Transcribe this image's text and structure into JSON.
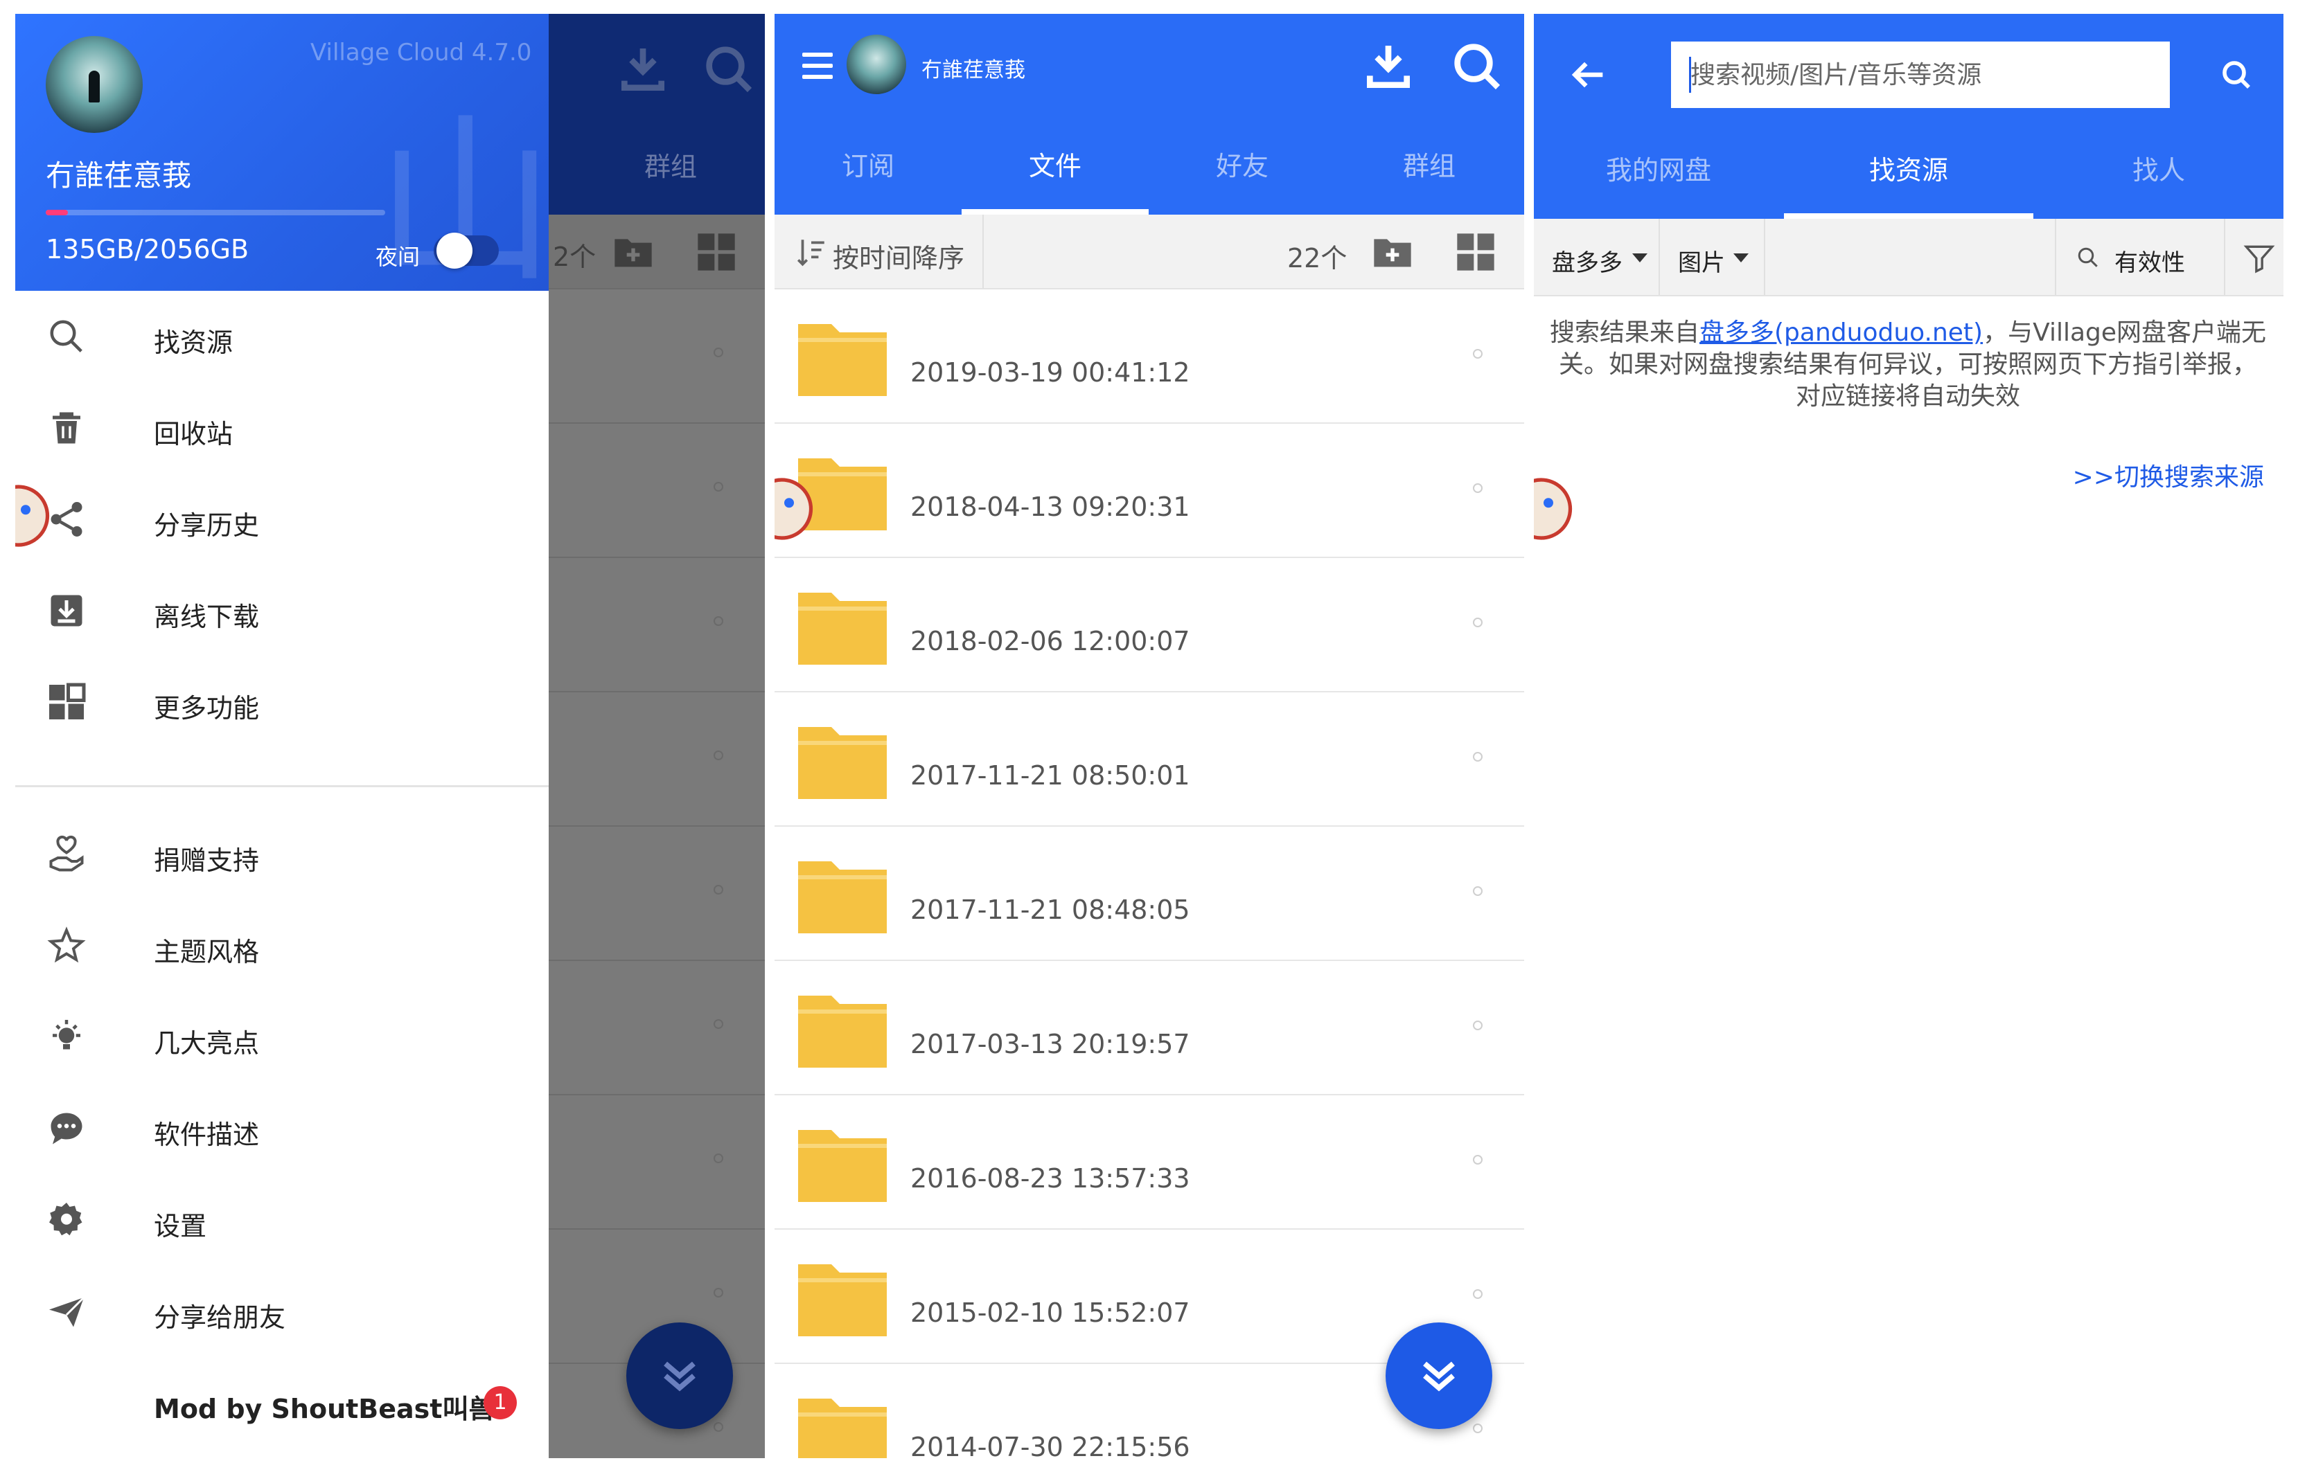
{
  "drawer": {
    "version": "Village Cloud 4.7.0",
    "username": "冇誰荏意莪",
    "quota": "135GB/2056GB",
    "quota_fraction": 0.066,
    "night_label": "夜间",
    "night_mode": false,
    "menu_primary": [
      {
        "label": "找资源",
        "icon": "search-icon"
      },
      {
        "label": "回收站",
        "icon": "trash-icon"
      },
      {
        "label": "分享历史",
        "icon": "share-icon"
      },
      {
        "label": "离线下载",
        "icon": "offline-download-icon"
      },
      {
        "label": "更多功能",
        "icon": "grid-icon"
      }
    ],
    "menu_secondary": [
      {
        "label": "捐赠支持",
        "icon": "donate-hand-heart-icon"
      },
      {
        "label": "主题风格",
        "icon": "theme-star-icon"
      },
      {
        "label": "几大亮点",
        "icon": "lightbulb-icon"
      },
      {
        "label": "软件描述",
        "icon": "chat-bubble-icon"
      },
      {
        "label": "设置",
        "icon": "gear-icon"
      },
      {
        "label": "分享给朋友",
        "icon": "paper-plane-icon"
      }
    ],
    "mod_label": "Mod by ShoutBeast叫兽",
    "mod_badge": "1"
  },
  "background": {
    "tab_visible": "群组",
    "count_partial": "2个"
  },
  "files_screen": {
    "title": "冇誰荏意莪",
    "tabs": [
      "订阅",
      "文件",
      "好友",
      "群组"
    ],
    "active_tab": 1,
    "sort_label": "按时间降序",
    "count": "22个",
    "files": [
      {
        "name": "",
        "date": "2019-03-19 00:41:12"
      },
      {
        "name": "",
        "date": "2018-04-13 09:20:31"
      },
      {
        "name": "",
        "date": "2018-02-06 12:00:07"
      },
      {
        "name": "",
        "date": "2017-11-21 08:50:01"
      },
      {
        "name": "",
        "date": "2017-11-21 08:48:05"
      },
      {
        "name": "",
        "date": "2017-03-13 20:19:57"
      },
      {
        "name": "",
        "date": "2016-08-23 13:57:33"
      },
      {
        "name": "",
        "date": "2015-02-10 15:52:07"
      },
      {
        "name": "",
        "date": "2014-07-30 22:15:56"
      }
    ]
  },
  "search_screen": {
    "placeholder": "搜索视频/图片/音乐等资源",
    "tabs": [
      "我的网盘",
      "找资源",
      "找人"
    ],
    "active_tab": 1,
    "source_dropdown": "盘多多",
    "type_dropdown": "图片",
    "validity_label": "有效性",
    "notice_prefix": "搜索结果来自",
    "notice_link": "盘多多(panduoduo.net)",
    "notice_suffix": "，与Village网盘客户端无关。如果对网盘搜索结果有何异议，可按照网页下方指引举报，对应链接将自动失效",
    "switch_source": ">>切换搜索来源"
  },
  "colors": {
    "primary": "#2a6cf6",
    "fab": "#1e5ae6",
    "folder": "#f5c242",
    "badge": "#e8303a",
    "quota_fill": "#ff3c7a"
  }
}
